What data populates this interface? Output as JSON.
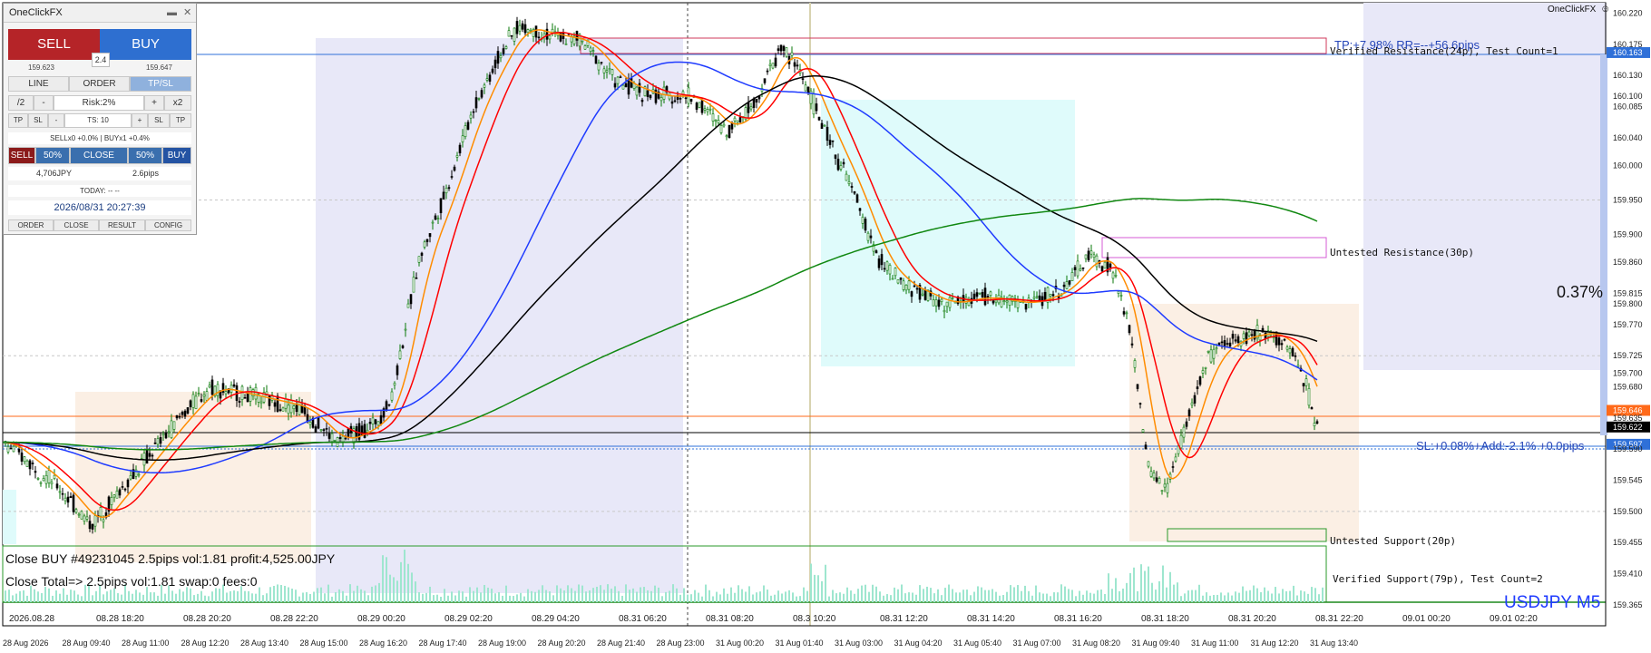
{
  "app": {
    "name": "OneClickFX"
  },
  "panel": {
    "title": "OneClickFX",
    "minimize": "▬",
    "close": "✕",
    "sell_label": "SELL",
    "buy_label": "BUY",
    "spread": "2.4",
    "bid": "159.623",
    "ask": "159.647",
    "tabs": [
      "LINE",
      "ORDER",
      "TP/SL"
    ],
    "risk_row": [
      "/2",
      "-",
      "Risk:2%",
      "+",
      "x2"
    ],
    "ts_row": [
      "TP",
      "SL",
      "-",
      "TS: 10",
      "+",
      "SL",
      "TP"
    ],
    "position_summary": "SELLx0 +0.0% | BUYx1 +0.4%",
    "close_row": [
      "SELL",
      "50%",
      "CLOSE",
      "50%",
      "BUY"
    ],
    "profit": "4,706JPY",
    "pips": "2.6pips",
    "today": "TODAY: -- --",
    "datetime": "2026/08/31  20:27:39",
    "footer_buttons": [
      "ORDER",
      "CLOSE",
      "RESULT",
      "CONFIG"
    ]
  },
  "chart": {
    "brand": "OneClickFX",
    "symbol": "USDJPY M5",
    "percent_label": "0.37%",
    "tp_label": "TP:+7.98% RR=--+56.6pips",
    "sl_label": "SL:+0.08%+Add:-2.1% +0.0pips",
    "zones": [
      "Verified Resistance(24p), Test Count=1",
      "Untested Resistance(30p)",
      "Untested Support(20p)",
      "Verified Support(79p), Test Count=2"
    ],
    "close_msg_1": "Close BUY #49231045 2.5pips vol:1.81 profit:4,525.00JPY",
    "close_msg_2": "Close Total=> 2.5pips vol:1.81 swap:0 fees:0",
    "price_labels": [
      "160.220",
      "160.175",
      "160.163",
      "160.130",
      "160.100",
      "160.085",
      "160.040",
      "160.000",
      "159.950",
      "159.900",
      "159.860",
      "159.815",
      "159.800",
      "159.770",
      "159.725",
      "159.700",
      "159.680",
      "159.646",
      "159.635",
      "159.622",
      "159.597",
      "159.590",
      "159.545",
      "159.500",
      "159.455",
      "159.410",
      "159.365"
    ],
    "time_labels": [
      "28 Aug 2026",
      "28 Aug 09:40",
      "28 Aug 11:00",
      "28 Aug 12:20",
      "28 Aug 13:40",
      "28 Aug 15:00",
      "28 Aug 16:20",
      "28 Aug 17:40",
      "28 Aug 19:00",
      "28 Aug 20:20",
      "28 Aug 21:40",
      "28 Aug 23:00",
      "31 Aug 00:20",
      "31 Aug 01:40",
      "31 Aug 03:00",
      "31 Aug 04:20",
      "31 Aug 05:40",
      "31 Aug 07:00",
      "31 Aug 08:20",
      "31 Aug 09:40",
      "31 Aug 11:00",
      "31 Aug 12:20",
      "31 Aug 13:40"
    ],
    "upper_time_labels": [
      "2026.08.28",
      "08.28 18:20",
      "08.28 20:20",
      "08.28 22:20",
      "08.29 00:20",
      "08.29 02:20",
      "08.29 04:20",
      "08.31 06:20",
      "08.31 08:20",
      "08.3  10:20",
      "08.31 12:20",
      "08.31 14:20",
      "08.31 16:20",
      "08.31 18:20",
      "08.31 20:20",
      "08.31 22:20",
      "09.01 00:20",
      "09.01 02:20"
    ],
    "colors": {
      "ema_fast": "#ff8c00",
      "ema_mid": "#ff0000",
      "ema_slow": "#1f3bff",
      "sma_long": "#000000",
      "sma_200": "#118811",
      "zone_blue": "#e8e8f8",
      "zone_cyan": "#dffbfb",
      "zone_peach": "#fbefe4",
      "volume": "#9ee6cf"
    }
  }
}
